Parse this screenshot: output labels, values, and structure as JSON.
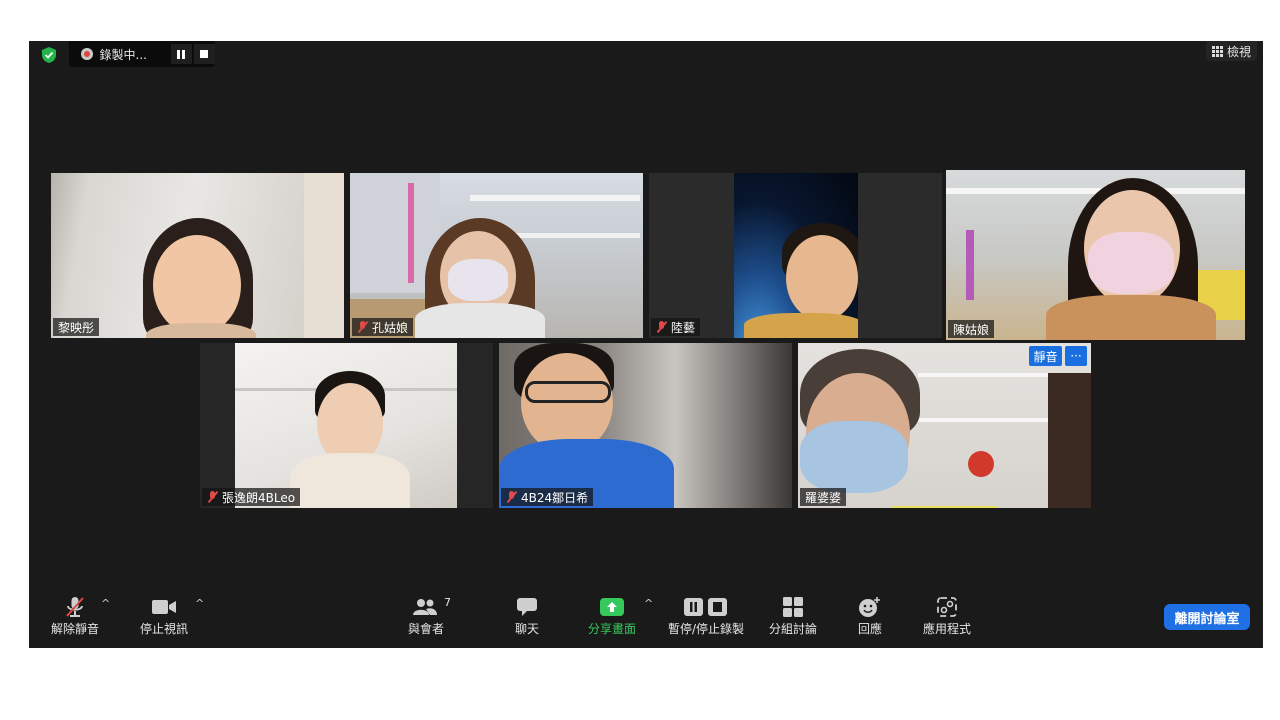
{
  "recording": {
    "label": "錄製中...",
    "pause_icon": "pause-icon",
    "stop_icon": "stop-icon"
  },
  "view": {
    "label": "檢視"
  },
  "participants": [
    {
      "name": "黎映彤",
      "muted": false
    },
    {
      "name": "孔姑娘",
      "muted": true
    },
    {
      "name": "陸藝",
      "muted": true
    },
    {
      "name": "陳姑娘",
      "muted": false,
      "active_speaker": true
    },
    {
      "name": "張逸朗4BLeo",
      "muted": true
    },
    {
      "name": "4B24鄒日希",
      "muted": true
    },
    {
      "name": "羅婆婆",
      "muted": false
    }
  ],
  "tile_overlay": {
    "mute_label": "靜音",
    "more_label": "···"
  },
  "toolbar": {
    "unmute": "解除靜音",
    "stop_video": "停止視訊",
    "participants": "與會者",
    "participant_count": "7",
    "chat": "聊天",
    "share_screen": "分享畫面",
    "pause_stop_recording": "暫停/停止錄製",
    "breakout_rooms": "分組討論",
    "reactions": "回應",
    "apps": "應用程式",
    "leave": "離開討論室"
  },
  "colors": {
    "window_bg": "#1a1a1a",
    "active_speaker_border": "#c6e34a",
    "share_green": "#37c95c",
    "leave_blue": "#1f6fe5",
    "muted_red": "#e04a48"
  }
}
